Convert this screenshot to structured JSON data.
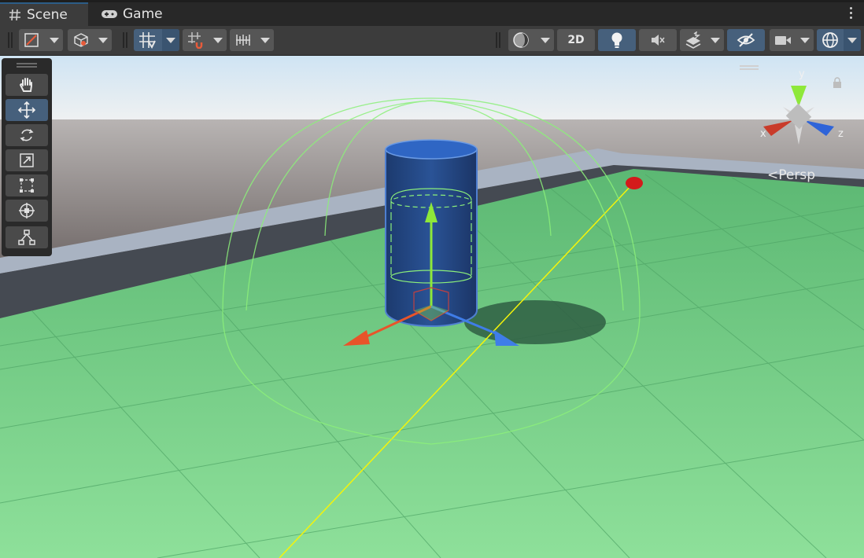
{
  "tabs": [
    {
      "label": "Scene",
      "icon": "hash-icon",
      "active": true
    },
    {
      "label": "Game",
      "icon": "gamepad-icon",
      "active": false
    }
  ],
  "toolbar": {
    "mode_2d_label": "2D",
    "buttons": [
      "draw-mode",
      "shaded-cube",
      "grid-snap",
      "increment-snap",
      "ruler",
      "shading-sphere",
      "2d-toggle",
      "lighting",
      "audio-mute",
      "effects",
      "scene-visibility",
      "camera",
      "gizmos"
    ]
  },
  "tools": [
    "hand-tool",
    "move-tool",
    "rotate-tool",
    "scale-tool",
    "rect-tool",
    "transform-tool",
    "custom-editor-tool"
  ],
  "active_tool": "move-tool",
  "gizmo": {
    "x_label": "x",
    "y_label": "y",
    "z_label": "z",
    "projection_label": "Persp"
  },
  "colors": {
    "accent": "#46607c",
    "floor": "#6fcb8a",
    "x_axis": "#e8542a",
    "y_axis": "#8ee83a",
    "z_axis": "#3f7de8"
  }
}
